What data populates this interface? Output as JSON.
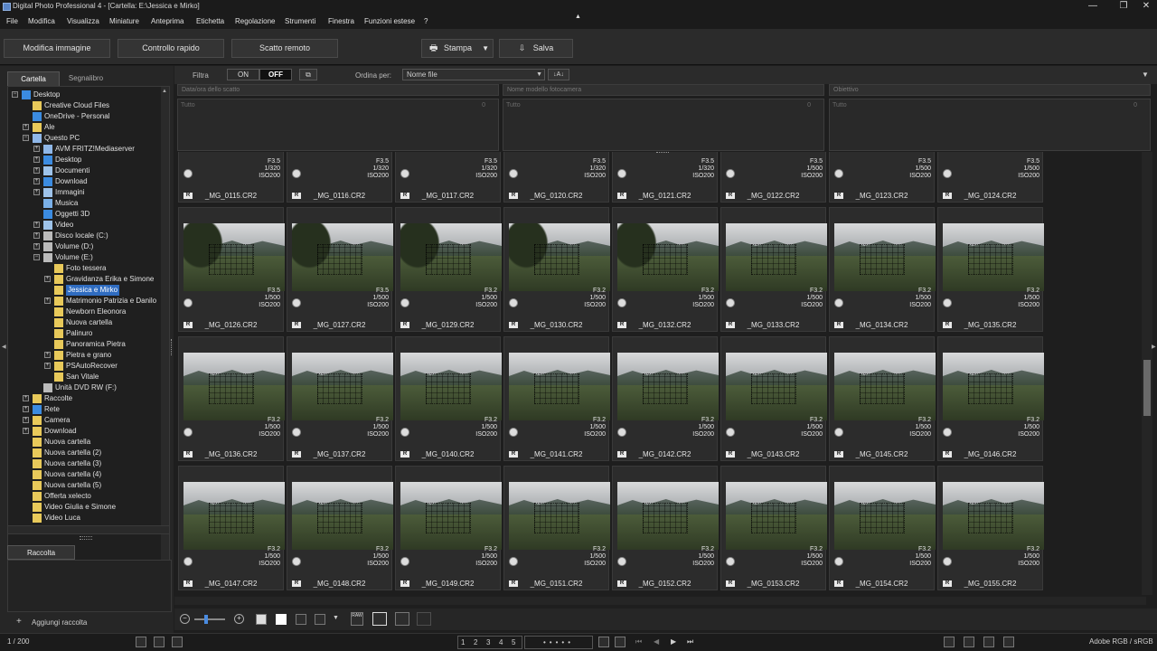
{
  "window": {
    "title": "Digital Photo Professional 4 - [Cartella: E:\\Jessica e Mirko]",
    "controls": [
      "—",
      "❐",
      "✕"
    ]
  },
  "menu": [
    "File",
    "Modifica",
    "Visualizza",
    "Miniature",
    "Anteprima",
    "Etichetta",
    "Regolazione",
    "Strumenti",
    "Finestra",
    "Funzioni estese",
    "?"
  ],
  "toolbar": {
    "edit_image": "Modifica immagine",
    "quick_check": "Controllo rapido",
    "remote_shooting": "Scatto remoto",
    "print": "Stampa",
    "save": "Salva"
  },
  "left_panel": {
    "tab_folder": "Cartella",
    "tab_bookmark": "Segnalibro",
    "tree": [
      {
        "label": "Desktop",
        "level": 0,
        "icon": "blue"
      },
      {
        "label": "Creative Cloud Files",
        "level": 1,
        "icon": "folder"
      },
      {
        "label": "OneDrive - Personal",
        "level": 1,
        "icon": "cloud"
      },
      {
        "label": "Ale",
        "level": 1,
        "icon": "user"
      },
      {
        "label": "Questo PC",
        "level": 1,
        "icon": "pc"
      },
      {
        "label": "AVM FRITZ!Mediaserver",
        "level": 2,
        "icon": "pc"
      },
      {
        "label": "Desktop",
        "level": 2,
        "icon": "blue"
      },
      {
        "label": "Documenti",
        "level": 2,
        "icon": "doc"
      },
      {
        "label": "Download",
        "level": 2,
        "icon": "download"
      },
      {
        "label": "Immagini",
        "level": 2,
        "icon": "doc"
      },
      {
        "label": "Musica",
        "level": 2,
        "icon": "music"
      },
      {
        "label": "Oggetti 3D",
        "level": 2,
        "icon": "blue"
      },
      {
        "label": "Video",
        "level": 2,
        "icon": "doc"
      },
      {
        "label": "Disco locale (C:)",
        "level": 2,
        "icon": "drive"
      },
      {
        "label": "Volume (D:)",
        "level": 2,
        "icon": "drive"
      },
      {
        "label": "Volume (E:)",
        "level": 2,
        "icon": "drive"
      },
      {
        "label": "Foto tessera",
        "level": 3,
        "icon": "folder"
      },
      {
        "label": "Gravidanza Erika e Simone",
        "level": 3,
        "icon": "folder"
      },
      {
        "label": "Jessica e Mirko",
        "level": 3,
        "icon": "folder",
        "selected": true
      },
      {
        "label": "Matrimonio Patrizia e Danilo",
        "level": 3,
        "icon": "folder"
      },
      {
        "label": "Newborn Eleonora",
        "level": 3,
        "icon": "folder"
      },
      {
        "label": "Nuova cartella",
        "level": 3,
        "icon": "folder"
      },
      {
        "label": "Palinuro",
        "level": 3,
        "icon": "folder"
      },
      {
        "label": "Panoramica Pietra",
        "level": 3,
        "icon": "folder"
      },
      {
        "label": "Pietra e grano",
        "level": 3,
        "icon": "folder"
      },
      {
        "label": "PSAutoRecover",
        "level": 3,
        "icon": "folder"
      },
      {
        "label": "San Vitale",
        "level": 3,
        "icon": "folder"
      },
      {
        "label": "Unità DVD RW (F:)",
        "level": 2,
        "icon": "drive"
      },
      {
        "label": "Raccolte",
        "level": 1,
        "icon": "folder"
      },
      {
        "label": "Rete",
        "level": 1,
        "icon": "blue"
      },
      {
        "label": "Camera",
        "level": 1,
        "icon": "folder"
      },
      {
        "label": "Download",
        "level": 1,
        "icon": "folder"
      },
      {
        "label": "Nuova cartella",
        "level": 1,
        "icon": "folder"
      },
      {
        "label": "Nuova cartella (2)",
        "level": 1,
        "icon": "folder"
      },
      {
        "label": "Nuova cartella (3)",
        "level": 1,
        "icon": "folder"
      },
      {
        "label": "Nuova cartella (4)",
        "level": 1,
        "icon": "folder"
      },
      {
        "label": "Nuova cartella (5)",
        "level": 1,
        "icon": "folder"
      },
      {
        "label": "Offerta xelecto",
        "level": 1,
        "icon": "folder"
      },
      {
        "label": "Video Giulia e Simone",
        "level": 1,
        "icon": "folder"
      },
      {
        "label": "Video Luca",
        "level": 1,
        "icon": "folder"
      }
    ],
    "raccolta_tab": "Raccolta",
    "add_collection": "Aggiungi raccolta"
  },
  "filter": {
    "label": "Filtra",
    "on": "ON",
    "off": "OFF",
    "sort_label": "Ordina per:",
    "sort_value": "Nome file",
    "columns": [
      {
        "header": "Data/ora dello scatto",
        "item": "Tutto",
        "count": "0"
      },
      {
        "header": "Nome modello fotocamera",
        "item": "Tutto",
        "count": "0"
      },
      {
        "header": "Obiettivo",
        "item": "Tutto",
        "count": "0"
      }
    ]
  },
  "thumbnails": [
    {
      "file": "_MG_0115.CR2",
      "ap": "F3.5",
      "sh": "1/320",
      "iso": "ISO200"
    },
    {
      "file": "_MG_0116.CR2",
      "ap": "F3.5",
      "sh": "1/320",
      "iso": "ISO200"
    },
    {
      "file": "_MG_0117.CR2",
      "ap": "F3.5",
      "sh": "1/320",
      "iso": "ISO200"
    },
    {
      "file": "_MG_0120.CR2",
      "ap": "F3.5",
      "sh": "1/320",
      "iso": "ISO200"
    },
    {
      "file": "_MG_0121.CR2",
      "ap": "F3.5",
      "sh": "1/320",
      "iso": "ISO200"
    },
    {
      "file": "_MG_0122.CR2",
      "ap": "F3.5",
      "sh": "1/500",
      "iso": "ISO200"
    },
    {
      "file": "_MG_0123.CR2",
      "ap": "F3.5",
      "sh": "1/500",
      "iso": "ISO200"
    },
    {
      "file": "_MG_0124.CR2",
      "ap": "F3.5",
      "sh": "1/500",
      "iso": "ISO200"
    },
    {
      "file": "_MG_0126.CR2",
      "ap": "F3.5",
      "sh": "1/500",
      "iso": "ISO200"
    },
    {
      "file": "_MG_0127.CR2",
      "ap": "F3.5",
      "sh": "1/500",
      "iso": "ISO200"
    },
    {
      "file": "_MG_0129.CR2",
      "ap": "F3.2",
      "sh": "1/500",
      "iso": "ISO200"
    },
    {
      "file": "_MG_0130.CR2",
      "ap": "F3.2",
      "sh": "1/500",
      "iso": "ISO200"
    },
    {
      "file": "_MG_0132.CR2",
      "ap": "F3.2",
      "sh": "1/500",
      "iso": "ISO200"
    },
    {
      "file": "_MG_0133.CR2",
      "ap": "F3.2",
      "sh": "1/500",
      "iso": "ISO200"
    },
    {
      "file": "_MG_0134.CR2",
      "ap": "F3.2",
      "sh": "1/500",
      "iso": "ISO200"
    },
    {
      "file": "_MG_0135.CR2",
      "ap": "F3.2",
      "sh": "1/500",
      "iso": "ISO200"
    },
    {
      "file": "_MG_0136.CR2",
      "ap": "F3.2",
      "sh": "1/500",
      "iso": "ISO200"
    },
    {
      "file": "_MG_0137.CR2",
      "ap": "F3.2",
      "sh": "1/500",
      "iso": "ISO200"
    },
    {
      "file": "_MG_0140.CR2",
      "ap": "F3.2",
      "sh": "1/500",
      "iso": "ISO200"
    },
    {
      "file": "_MG_0141.CR2",
      "ap": "F3.2",
      "sh": "1/500",
      "iso": "ISO200"
    },
    {
      "file": "_MG_0142.CR2",
      "ap": "F3.2",
      "sh": "1/500",
      "iso": "ISO200"
    },
    {
      "file": "_MG_0143.CR2",
      "ap": "F3.2",
      "sh": "1/500",
      "iso": "ISO200"
    },
    {
      "file": "_MG_0145.CR2",
      "ap": "F3.2",
      "sh": "1/500",
      "iso": "ISO200"
    },
    {
      "file": "_MG_0146.CR2",
      "ap": "F3.2",
      "sh": "1/500",
      "iso": "ISO200"
    },
    {
      "file": "_MG_0147.CR2",
      "ap": "F3.2",
      "sh": "1/500",
      "iso": "ISO200"
    },
    {
      "file": "_MG_0148.CR2",
      "ap": "F3.2",
      "sh": "1/500",
      "iso": "ISO200"
    },
    {
      "file": "_MG_0149.CR2",
      "ap": "F3.2",
      "sh": "1/500",
      "iso": "ISO200"
    },
    {
      "file": "_MG_0151.CR2",
      "ap": "F3.2",
      "sh": "1/500",
      "iso": "ISO200"
    },
    {
      "file": "_MG_0152.CR2",
      "ap": "F3.2",
      "sh": "1/500",
      "iso": "ISO200"
    },
    {
      "file": "_MG_0153.CR2",
      "ap": "F3.2",
      "sh": "1/500",
      "iso": "ISO200"
    },
    {
      "file": "_MG_0154.CR2",
      "ap": "F3.2",
      "sh": "1/500",
      "iso": "ISO200"
    },
    {
      "file": "_MG_0155.CR2",
      "ap": "F3.2",
      "sh": "1/500",
      "iso": "ISO200"
    }
  ],
  "raw_badge": "R",
  "status": {
    "count": "1 / 200",
    "color_space": "Adobe RGB / sRGB",
    "ratings": [
      "1",
      "2",
      "3",
      "4",
      "5"
    ]
  },
  "colors": {
    "background": "#1e1e1e",
    "selection": "#2f6cc0",
    "folder": "#e8c95a"
  }
}
